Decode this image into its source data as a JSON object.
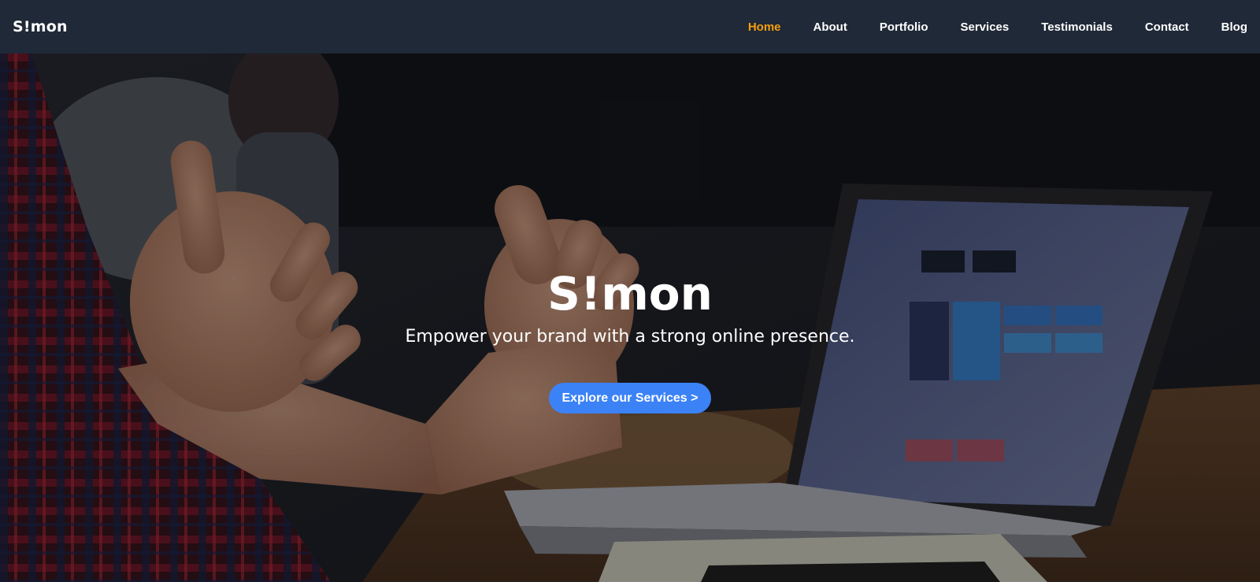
{
  "navbar": {
    "brand": "S!mon",
    "links": [
      {
        "label": "Home",
        "active": true
      },
      {
        "label": "About"
      },
      {
        "label": "Portfolio"
      },
      {
        "label": "Services"
      },
      {
        "label": "Testimonials"
      },
      {
        "label": "Contact"
      },
      {
        "label": "Blog"
      }
    ]
  },
  "hero": {
    "title": "S!mon",
    "subtitle": "Empower your brand with a strong online presence.",
    "cta_label": "Explore our Services >"
  },
  "colors": {
    "navbar_bg": "#1f2937",
    "active_link": "#f59e0b",
    "cta_bg": "#3b82f6"
  }
}
